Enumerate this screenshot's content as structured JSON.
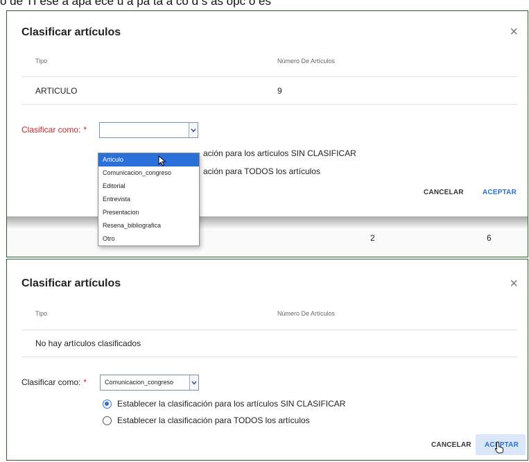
{
  "caption": "ó de TI ese a apa ece u a pa ta a co d s as opc o es",
  "colors": {
    "accent": "#2b6fd8",
    "required": "#d32020",
    "label_red": "#c62828",
    "panel_border": "#2a5f2a"
  },
  "panel1": {
    "title": "Clasificar artículos",
    "close_icon": "close-icon",
    "col_tipo": "Tipo",
    "col_numero": "Número De Artículos",
    "row_tipo": "ARTICULO",
    "row_numero": "9",
    "clasificar_label": "Clasificar como:",
    "required_mark": "*",
    "select_value": "",
    "radio1_partial": "ación para los artículos SIN CLASIFICAR",
    "radio2_partial": "ación para TODOS los artículos",
    "cancel": "CANCELAR",
    "accept": "ACEPTAR",
    "dropdown_options": [
      "Articulo",
      "Comunicacion_congreso",
      "Editorial",
      "Entrevista",
      "Presentacion",
      "Resena_bibliografica",
      "Otro"
    ],
    "dropdown_highlighted": "Articulo",
    "background_row": [
      "2",
      "6"
    ]
  },
  "panel2": {
    "title": "Clasificar artículos",
    "col_tipo": "Tipo",
    "col_numero": "Número De Artículos",
    "empty_message": "No hay artículos clasificados",
    "clasificar_label": "Clasificar como:",
    "required_mark": "*",
    "select_value": "Comunicacion_congreso",
    "radio1": "Establecer la clasificación para los artículos SIN CLASIFICAR",
    "radio2": "Establecer la clasificación para TODOS los artículos",
    "radio_selected": 1,
    "cancel": "CANCELAR",
    "accept": "ACEPTAR"
  }
}
